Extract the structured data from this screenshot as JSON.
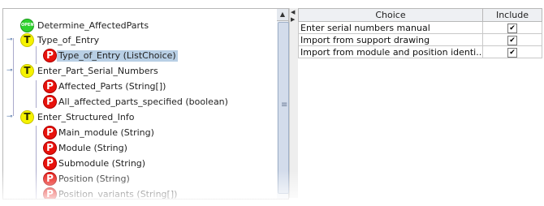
{
  "tree": {
    "root": {
      "label": "Determine_AffectedParts",
      "badge": "OPEN"
    },
    "nodes": [
      {
        "badge": "T",
        "label": "Type_of_Entry"
      },
      {
        "badge": "P",
        "label": "Type_of_Entry (ListChoice)",
        "selected": true
      },
      {
        "badge": "T",
        "label": "Enter_Part_Serial_Numbers"
      },
      {
        "badge": "P",
        "label": "Affected_Parts  (String[])"
      },
      {
        "badge": "P",
        "label": "All_affected_parts_specified (boolean)"
      },
      {
        "badge": "T",
        "label": "Enter_Structured_Info"
      },
      {
        "badge": "P",
        "label": "Main_module (String)"
      },
      {
        "badge": "P",
        "label": "Module (String)"
      },
      {
        "badge": "P",
        "label": "Submodule (String)"
      },
      {
        "badge": "P",
        "label": "Position (String)"
      },
      {
        "badge": "P",
        "label": "Position_variants (String[])"
      }
    ]
  },
  "table": {
    "headers": {
      "choice": "Choice",
      "include": "Include"
    },
    "rows": [
      {
        "choice": "Enter serial numbers manual",
        "include": true
      },
      {
        "choice": "Import from support drawing",
        "include": true
      },
      {
        "choice": "Import from module and position identi...",
        "include": true
      }
    ]
  },
  "glyphs": {
    "check": "✔",
    "scroll_up": "▲",
    "toggle": "⊸",
    "splitter_left": "◀",
    "splitter_right": "▶",
    "grip": "≡"
  }
}
